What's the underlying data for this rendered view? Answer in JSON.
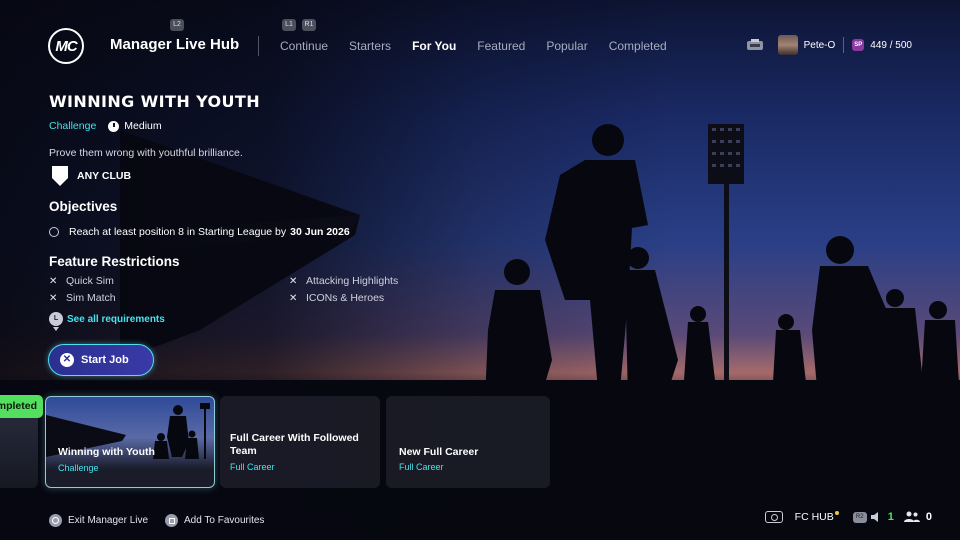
{
  "header": {
    "logo_text": "MC",
    "app_title": "Manager Live Hub",
    "hint_l2": "L2",
    "hint_l1": "L1",
    "hint_r1": "R1",
    "tabs": [
      {
        "label": "Continue",
        "active": false
      },
      {
        "label": "Starters",
        "active": false
      },
      {
        "label": "For You",
        "active": true
      },
      {
        "label": "Featured",
        "active": false
      },
      {
        "label": "Popular",
        "active": false
      },
      {
        "label": "Completed",
        "active": false
      }
    ],
    "user": {
      "name": "Pete-O",
      "sp_label": "SP",
      "points": "449 / 500"
    }
  },
  "challenge": {
    "title": "WINNING WITH YOUTH",
    "type": "Challenge",
    "difficulty": "Medium",
    "description": "Prove them wrong with youthful brilliance.",
    "club": "ANY CLUB",
    "objectives_heading": "Objectives",
    "objective_text": "Reach at least position 8 in Starting League by",
    "objective_date": "30 Jun 2026",
    "restrictions_heading": "Feature Restrictions",
    "restrictions": [
      "Quick Sim",
      "Sim Match",
      "Attacking Highlights",
      "ICONs & Heroes"
    ],
    "see_all_key": "L",
    "see_all": "See all requirements",
    "start_button": "Start Job"
  },
  "carousel": {
    "prev_badge": "Completed",
    "cards": [
      {
        "title": "Winning with Youth",
        "subtitle": "Challenge",
        "selected": true
      },
      {
        "title": "Full Career With Followed Team",
        "subtitle": "Full Career",
        "selected": false
      },
      {
        "title": "New Full Career",
        "subtitle": "Full Career",
        "selected": false
      }
    ]
  },
  "footer": {
    "exit_label": "Exit Manager Live",
    "fav_label": "Add To Favourites",
    "hub_label": "FC HUB",
    "r2_label": "R2",
    "notifications_count": "1",
    "friends_count": "0"
  },
  "colors": {
    "accent_cyan": "#46e3f0",
    "completed_green": "#53e05f",
    "start_button_fill": "#2a2f8f"
  }
}
